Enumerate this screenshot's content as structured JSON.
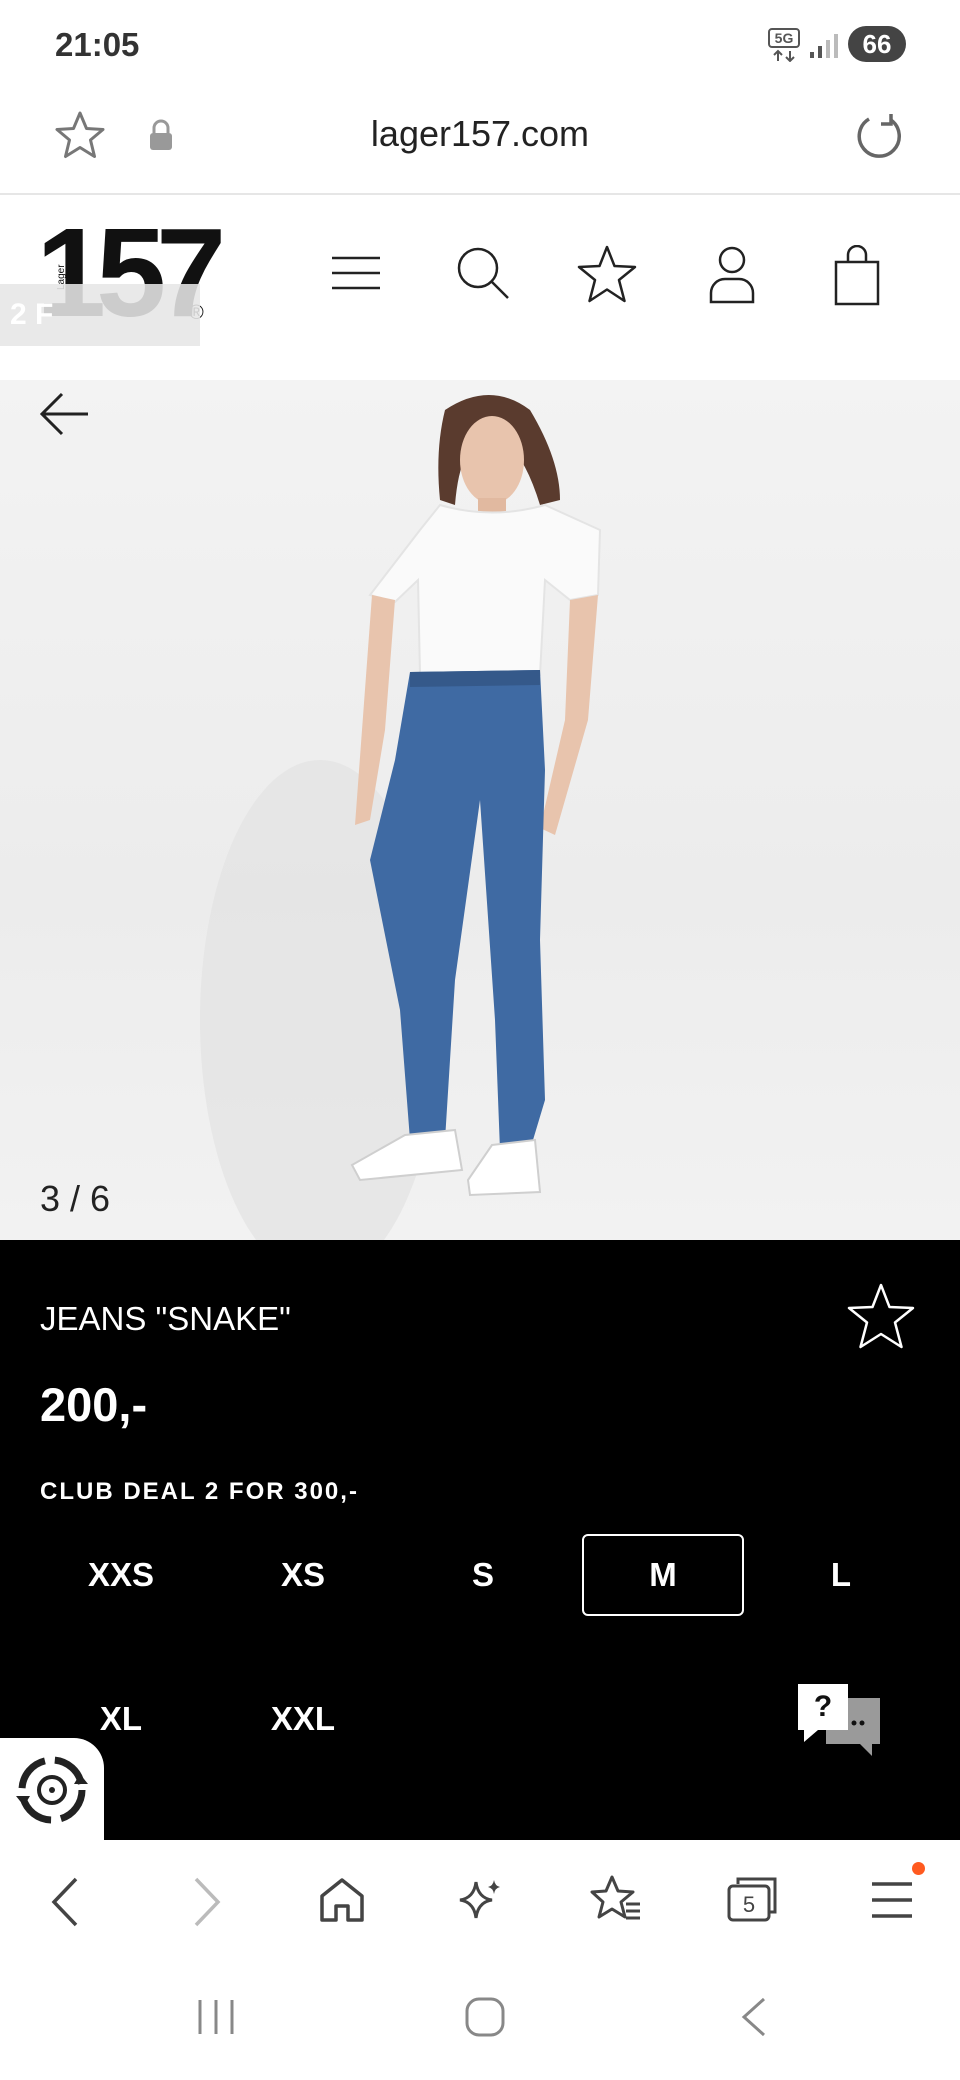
{
  "status_bar": {
    "time": "21:05",
    "network": "5G",
    "battery": "66"
  },
  "url_bar": {
    "url": "lager157.com"
  },
  "site_header": {
    "logo_number": "157",
    "logo_small": "Lager",
    "logo_reg": "®",
    "promo_banner": "2 F"
  },
  "gallery": {
    "counter": "3 / 6"
  },
  "product": {
    "name": "JEANS \"SNAKE\"",
    "price": "200,-",
    "club_deal": "CLUB DEAL 2 FOR 300,-",
    "sizes": [
      "XXS",
      "XS",
      "S",
      "M",
      "L",
      "XL",
      "XXL"
    ],
    "selected_size": "M"
  },
  "chat": {
    "label": "?"
  },
  "browser_bar": {
    "tabs_count": "5"
  },
  "colors": {
    "panel": "#000000",
    "notification": "#ff5a1f"
  }
}
